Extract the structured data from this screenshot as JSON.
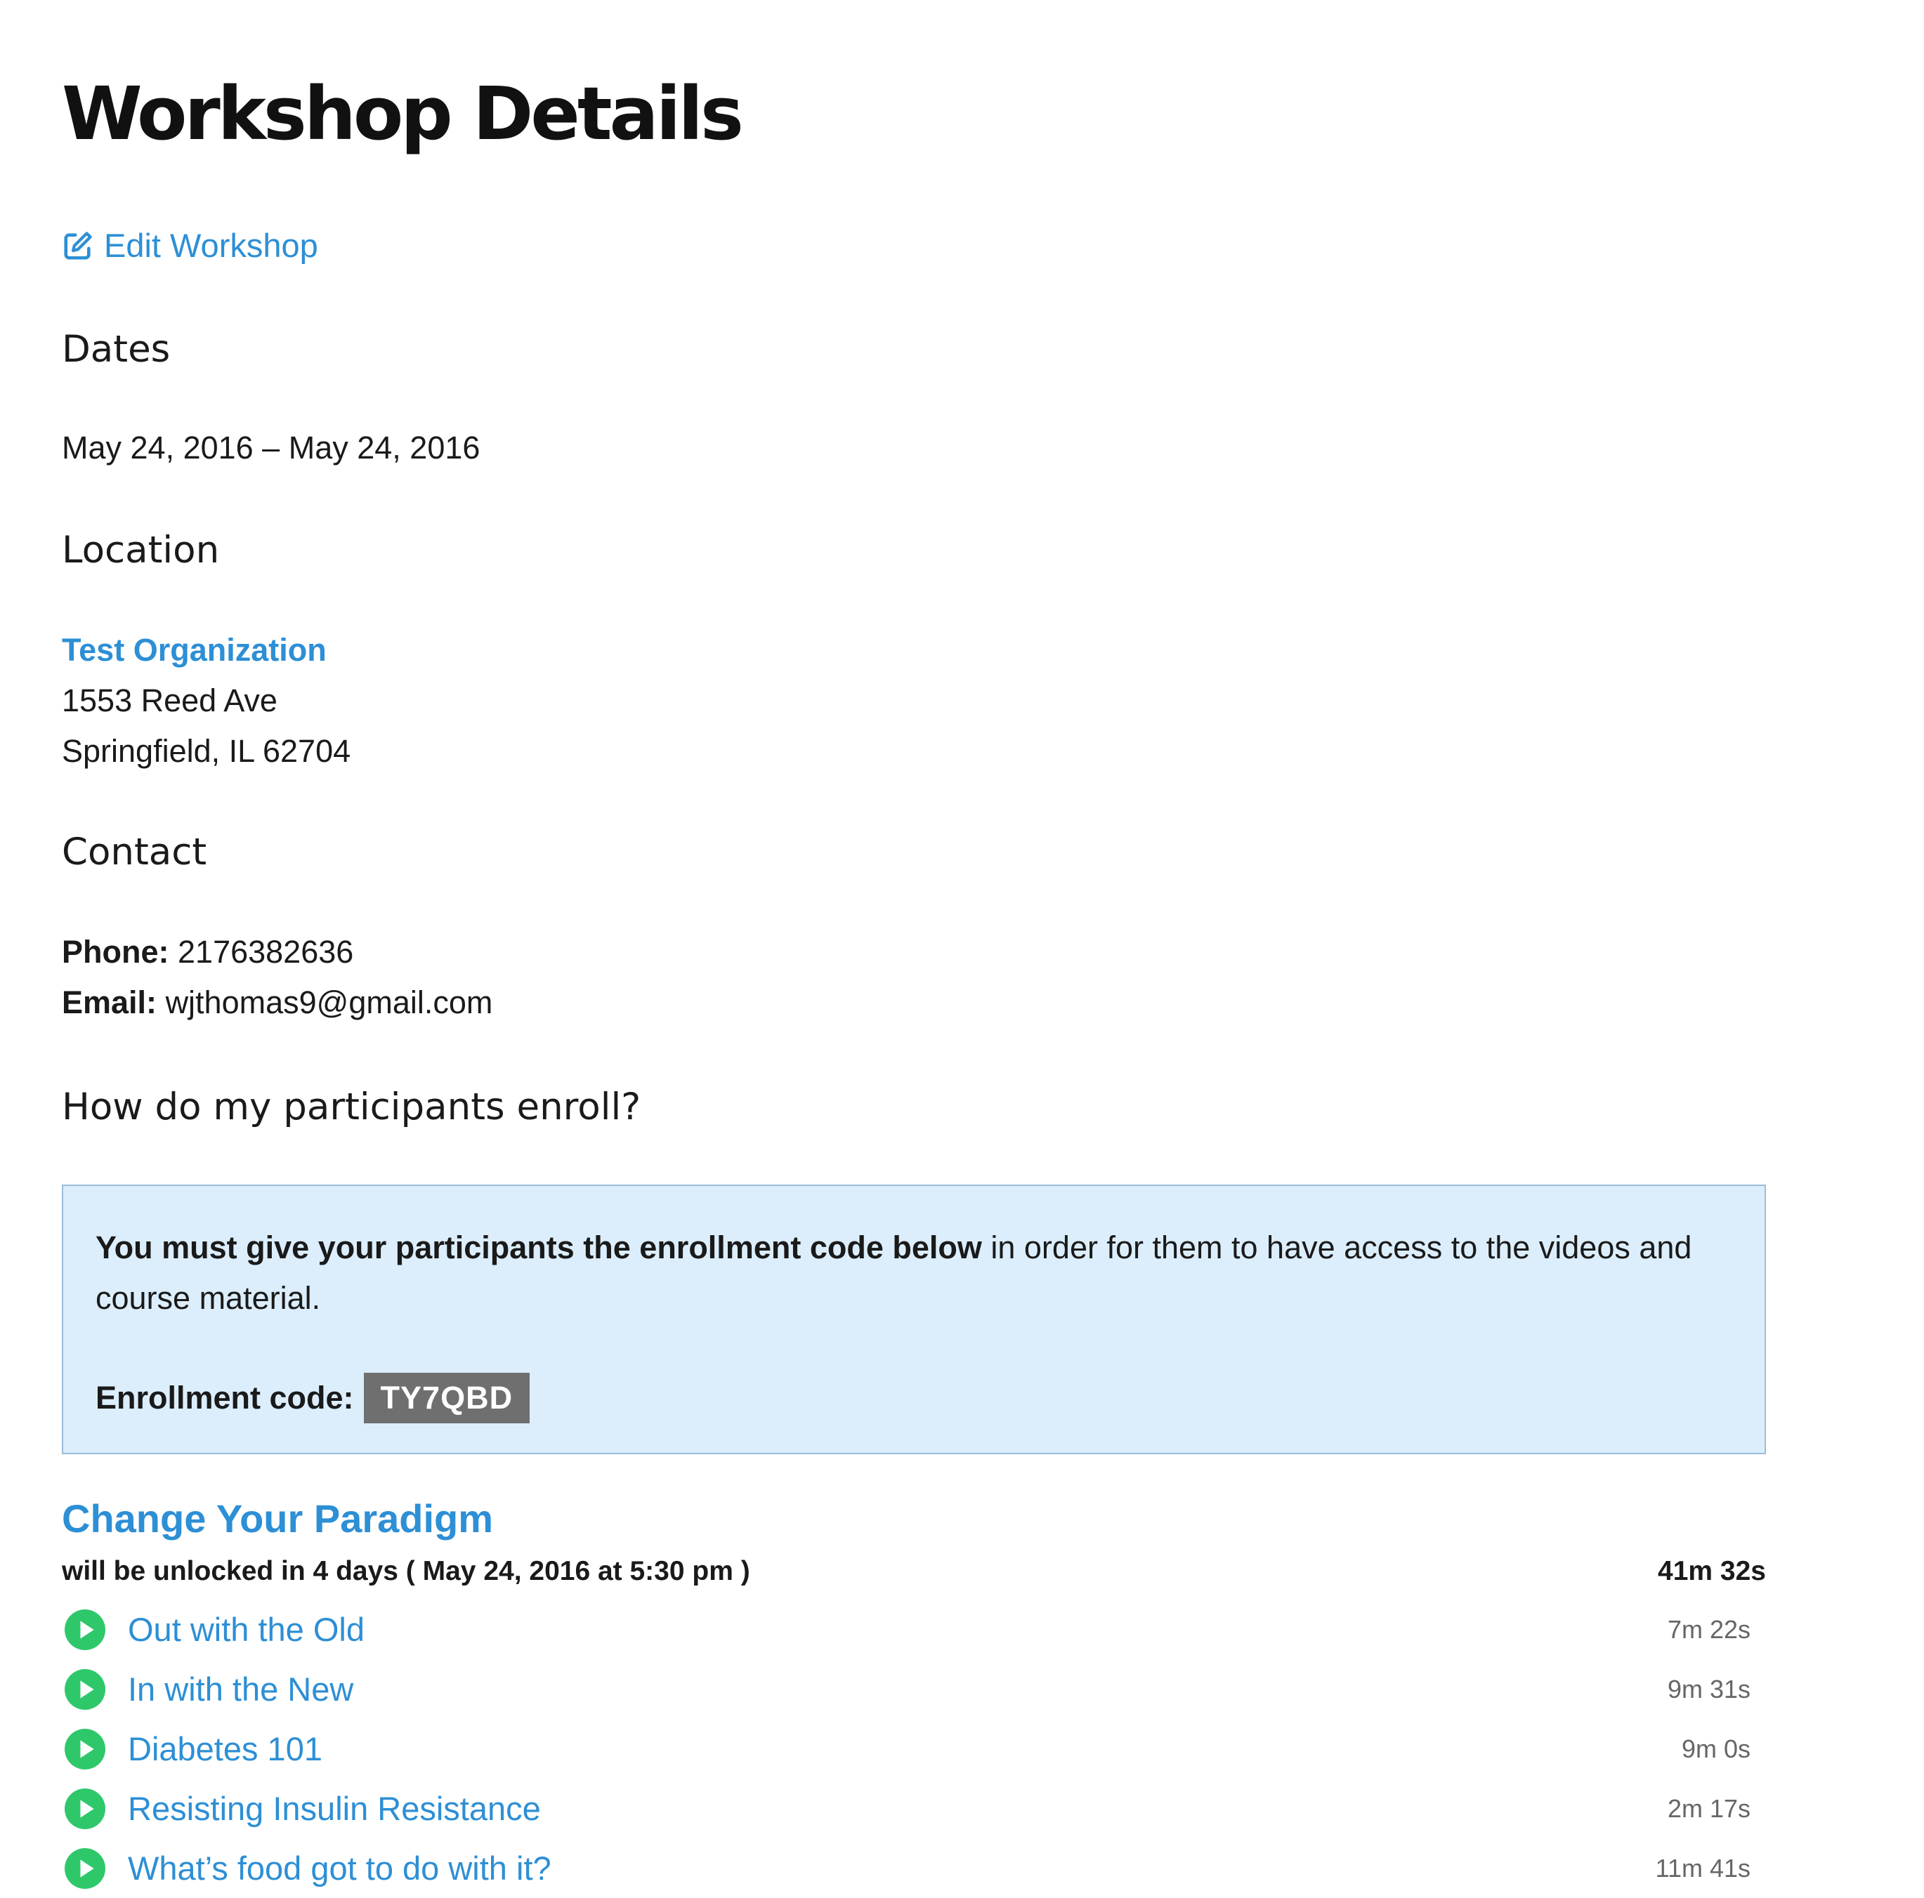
{
  "page_title": "Workshop Details",
  "edit_link": {
    "label": "Edit Workshop",
    "icon": "edit-icon"
  },
  "dates": {
    "heading": "Dates",
    "range": "May 24, 2016 – May 24, 2016"
  },
  "location": {
    "heading": "Location",
    "organization": "Test Organization",
    "street": "1553 Reed Ave",
    "city_line": "Springfield, IL 62704"
  },
  "contact": {
    "heading": "Contact",
    "phone_label": "Phone:",
    "phone": "2176382636",
    "email_label": "Email:",
    "email": "wjthomas9@gmail.com"
  },
  "enroll": {
    "heading": "How do my participants enroll?",
    "notice_bold": "You must give your participants the enrollment code below",
    "notice_rest": " in order for them to have access to the videos and course material.",
    "code_label": "Enrollment code:",
    "code": "TY7QBD"
  },
  "course": {
    "title": "Change Your Paradigm",
    "unlock_text": "will be unlocked in 4 days ( May 24, 2016 at 5:30 pm )",
    "total_duration": "41m 32s",
    "lessons": [
      {
        "title": "Out with the Old",
        "duration": "7m 22s"
      },
      {
        "title": "In with the New",
        "duration": "9m 31s"
      },
      {
        "title": "Diabetes 101",
        "duration": "9m 0s"
      },
      {
        "title": "Resisting Insulin Resistance",
        "duration": "2m 17s"
      },
      {
        "title": "What’s food got to do with it?",
        "duration": "11m 41s"
      }
    ]
  },
  "colors": {
    "link": "#2d8fd5",
    "play_icon": "#2ec86b",
    "notice_bg": "#dceefb",
    "code_badge_bg": "#6f6f6f"
  }
}
